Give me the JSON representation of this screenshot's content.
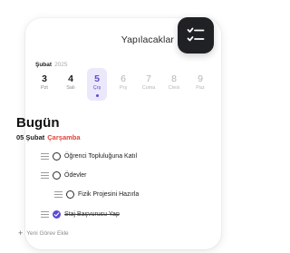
{
  "header": {
    "title": "Yapılacaklar",
    "app_icon": "checklist-icon"
  },
  "calendar": {
    "month": "Şubat",
    "year": "2025",
    "days": [
      {
        "num": "3",
        "name": "Pzt",
        "state": "past"
      },
      {
        "num": "4",
        "name": "Salı",
        "state": "past"
      },
      {
        "num": "5",
        "name": "Çrş",
        "state": "selected"
      },
      {
        "num": "6",
        "name": "Prş",
        "state": "future"
      },
      {
        "num": "7",
        "name": "Cuma",
        "state": "future"
      },
      {
        "num": "8",
        "name": "Ctesi",
        "state": "future"
      },
      {
        "num": "9",
        "name": "Paz",
        "state": "future"
      }
    ]
  },
  "today": {
    "heading": "Bugün",
    "date": "05 Şubat",
    "weekday": "Çarşamba"
  },
  "tasks": [
    {
      "label": "Öğrenci Topluluğuna Katıl",
      "done": false,
      "indent": 0
    },
    {
      "label": "Ödevler",
      "done": false,
      "indent": 0
    },
    {
      "label": "Fizik Projesini Hazırla",
      "done": false,
      "indent": 1
    },
    {
      "label": "Staj Başvurusu Yap",
      "done": true,
      "indent": 0
    }
  ],
  "add_task": {
    "label": "Yeni Görev Ekle"
  },
  "colors": {
    "accent": "#5a4ad8",
    "accent_bg": "#ece8fb",
    "weekday_red": "#e2433a",
    "icon_bg": "#1f2125"
  }
}
